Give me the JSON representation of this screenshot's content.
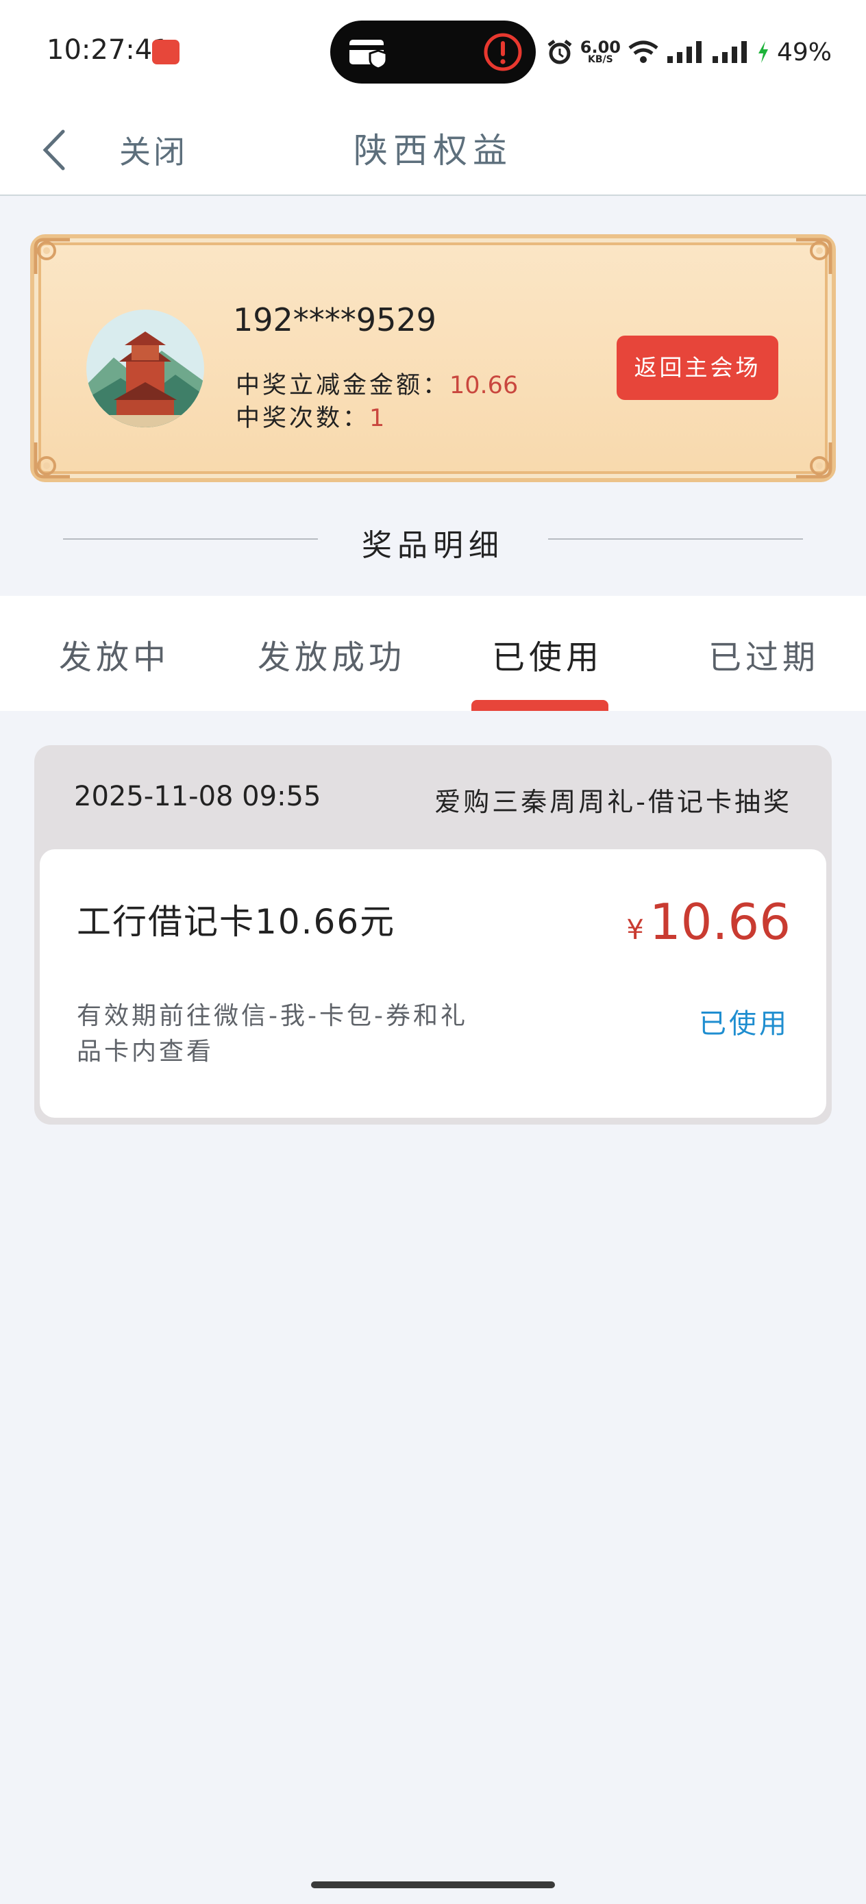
{
  "status_bar": {
    "time": "10:27:41",
    "app_badge": "",
    "network_speed_value": "6.00",
    "network_speed_unit": "KB/S",
    "battery": "49%"
  },
  "nav": {
    "close_label": "关闭",
    "title": "陕西权益"
  },
  "summary": {
    "phone": "192****9529",
    "amount_label": "中奖立减金金额：",
    "amount_value": "10.66",
    "count_label": "中奖次数：",
    "count_value": "1",
    "return_button": "返回主会场"
  },
  "section_title": "奖品明细",
  "tabs": [
    {
      "label": "发放中",
      "active": false
    },
    {
      "label": "发放成功",
      "active": false
    },
    {
      "label": "已使用",
      "active": true
    },
    {
      "label": "已过期",
      "active": false
    }
  ],
  "records": [
    {
      "datetime": "2025-11-08  09:55",
      "source": "爱购三秦周周礼-借记卡抽奖",
      "prize_name": "工行借记卡10.66元",
      "currency_symbol": "¥",
      "amount": "10.66",
      "description": "有效期前往微信-我-卡包-券和礼品卡内查看",
      "status": "已使用"
    }
  ],
  "colors": {
    "accent_red": "#e7453a",
    "amount_red": "#c93b31",
    "status_blue": "#1f8ed0",
    "card_gold": "#fbe6c6"
  },
  "icons": [
    "back-chevron-icon",
    "card-shield-icon",
    "alert-icon",
    "alarm-icon",
    "wifi-icon",
    "signal-icon",
    "charging-icon"
  ]
}
